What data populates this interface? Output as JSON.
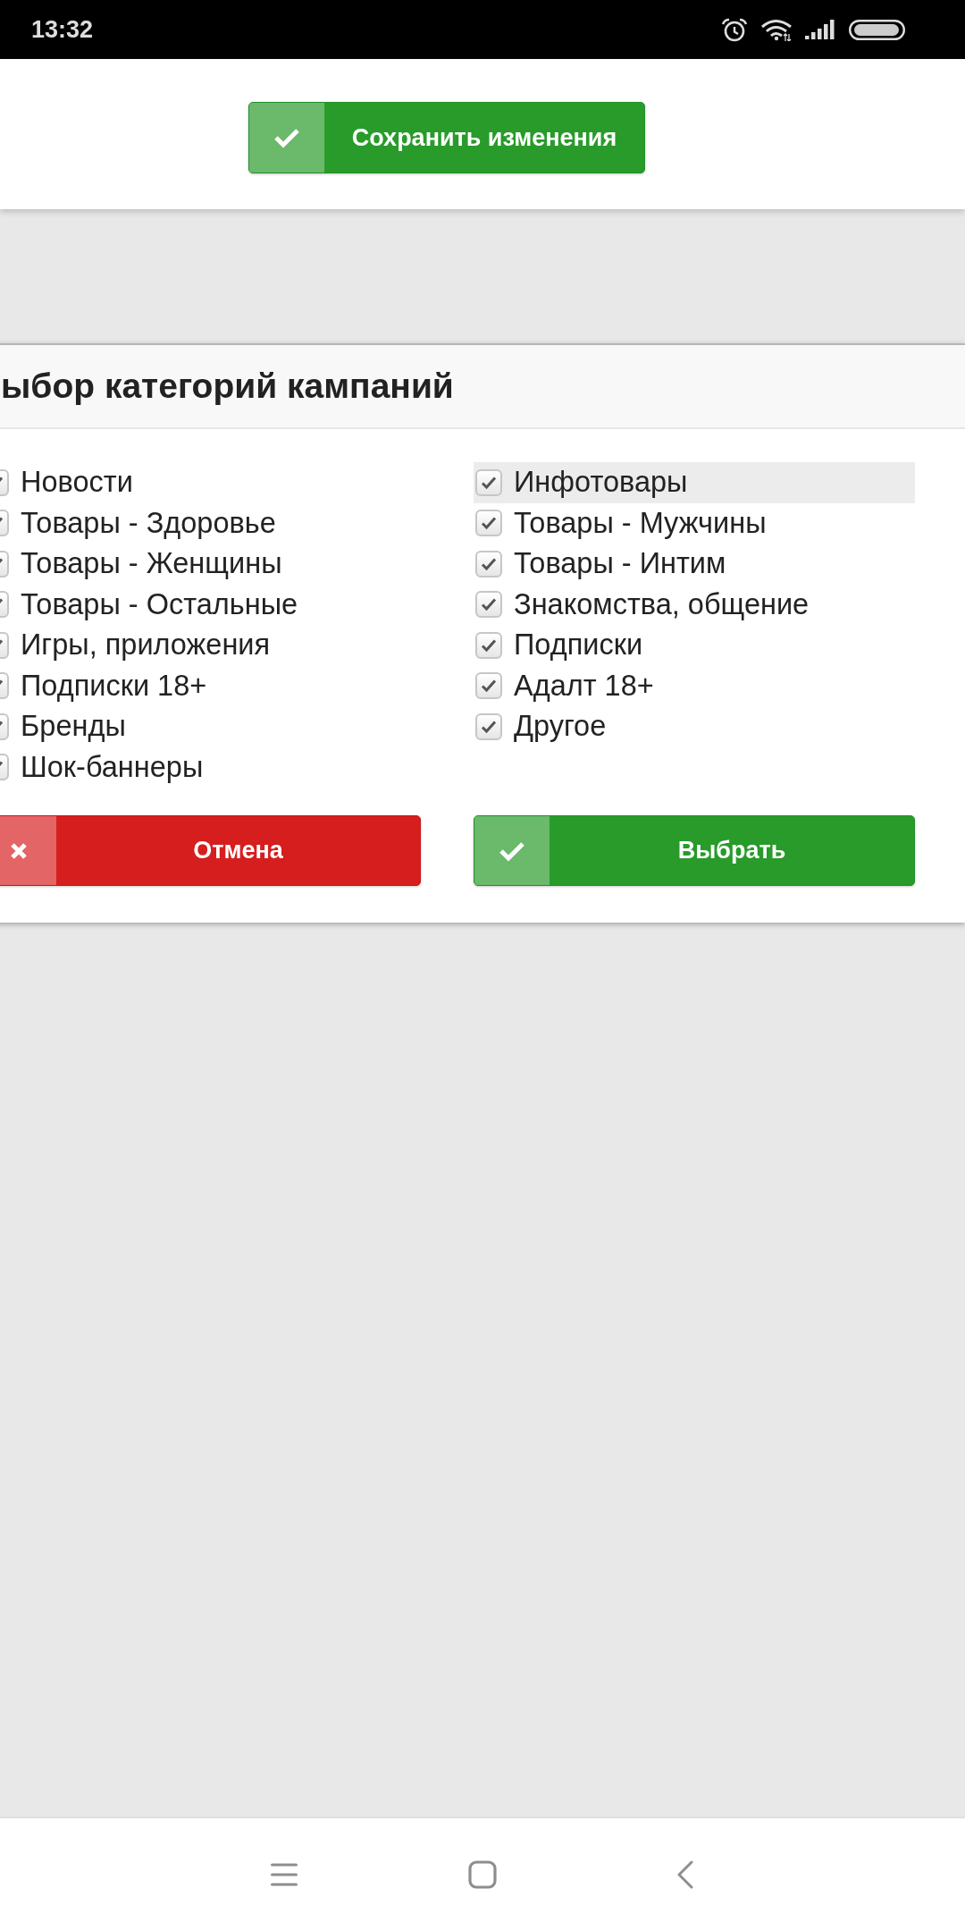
{
  "status_bar": {
    "time": "13:32"
  },
  "toolbar": {
    "save_button": {
      "label": "Сохранить изменения"
    }
  },
  "dialog": {
    "title": "ыбор категорий кампаний",
    "columns": [
      {
        "items": [
          {
            "label": "Новости",
            "checked": true,
            "selected": false
          },
          {
            "label": "Товары - Здоровье",
            "checked": true,
            "selected": false
          },
          {
            "label": "Товары - Женщины",
            "checked": true,
            "selected": false
          },
          {
            "label": "Товары - Остальные",
            "checked": true,
            "selected": false
          },
          {
            "label": "Игры, приложения",
            "checked": true,
            "selected": false
          },
          {
            "label": "Подписки 18+",
            "checked": true,
            "selected": false
          },
          {
            "label": "Бренды",
            "checked": true,
            "selected": false
          },
          {
            "label": "Шок-баннеры",
            "checked": true,
            "selected": false
          }
        ]
      },
      {
        "items": [
          {
            "label": "Инфотовары",
            "checked": true,
            "selected": true
          },
          {
            "label": "Товары - Мужчины",
            "checked": true,
            "selected": false
          },
          {
            "label": "Товары - Интим",
            "checked": true,
            "selected": false
          },
          {
            "label": "Знакомства, общение",
            "checked": true,
            "selected": false
          },
          {
            "label": "Подписки",
            "checked": true,
            "selected": false
          },
          {
            "label": "Адалт 18+",
            "checked": true,
            "selected": false
          },
          {
            "label": "Другое",
            "checked": true,
            "selected": false
          }
        ]
      }
    ],
    "buttons": [
      {
        "kind": "cancel",
        "label": "Отмена"
      },
      {
        "kind": "confirm",
        "label": "Выбрать"
      }
    ]
  }
}
